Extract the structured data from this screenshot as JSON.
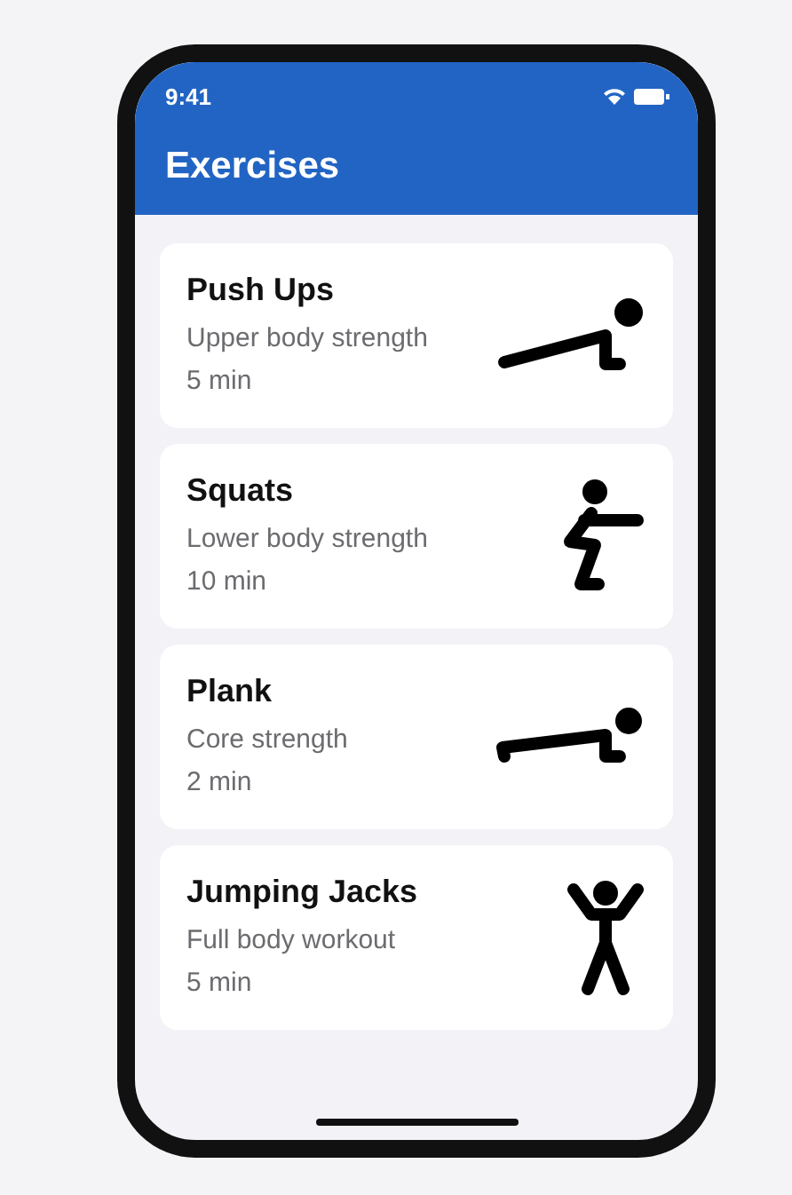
{
  "status_bar": {
    "time": "9:41"
  },
  "header": {
    "title": "Exercises"
  },
  "exercises": [
    {
      "name": "Push Ups",
      "description": "Upper body strength",
      "duration": "5 min",
      "kind": "pushup"
    },
    {
      "name": "Squats",
      "description": "Lower body strength",
      "duration": "10 min",
      "kind": "squat"
    },
    {
      "name": "Plank",
      "description": "Core strength",
      "duration": "2 min",
      "kind": "plank"
    },
    {
      "name": "Jumping Jacks",
      "description": "Full body workout",
      "duration": "5 min",
      "kind": "jumping"
    }
  ]
}
